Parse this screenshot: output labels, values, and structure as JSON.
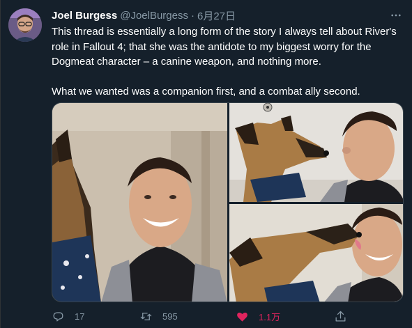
{
  "tweet": {
    "author_name": "Joel Burgess",
    "handle": "@JoelBurgess",
    "separator": "·",
    "date": "6月27日",
    "paragraph_1": "This thread is essentially a long form of the story I always tell about River's role in Fallout 4; that she was the antidote to my biggest worry for the Dogmeat character – a canine weapon, and nothing more.",
    "paragraph_2": "What we wanted was a companion first, and a combat ally second."
  },
  "actions": {
    "reply_count": "17",
    "retweet_count": "595",
    "like_count": "1.1万"
  },
  "icons": {
    "more": "more-horizontal-icon",
    "reply": "reply-icon",
    "retweet": "retweet-icon",
    "like": "heart-icon",
    "share": "share-icon"
  },
  "colors": {
    "background": "#15202b",
    "secondary_text": "#8899a6",
    "like_accent": "#e0245e"
  }
}
